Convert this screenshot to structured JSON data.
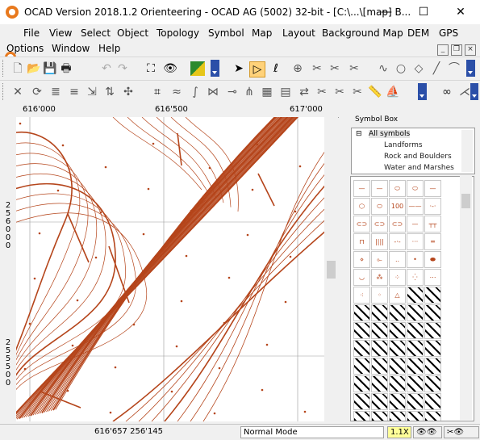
{
  "window": {
    "title": "OCAD Version 2018.1.2  Orienteering - OCAD AG (5002) 32-bit - [C:\\...\\[map] B...",
    "minimize": "—",
    "maximize": "☐",
    "close": "✕"
  },
  "menu": {
    "row1": [
      "File",
      "View",
      "Select",
      "Object",
      "Topology",
      "Symbol",
      "Map",
      "Layout",
      "Background Map",
      "DEM",
      "GPS"
    ],
    "row2": [
      "Options",
      "Window",
      "Help"
    ]
  },
  "map": {
    "ruler_x": [
      "616'000",
      "616'500",
      "617'000"
    ],
    "ruler_y": [
      "256000",
      "255500"
    ],
    "grid_color": "#999999",
    "contour_color": "#b5451b"
  },
  "symbol_box": {
    "title": "Symbol Box",
    "tree_root": "All symbols",
    "tree_items": [
      "Landforms",
      "Rock and Boulders",
      "Water and Marshes"
    ]
  },
  "status": {
    "coords": "616'657   256'145",
    "mode": "Normal Mode",
    "zoom": "1.1X"
  }
}
